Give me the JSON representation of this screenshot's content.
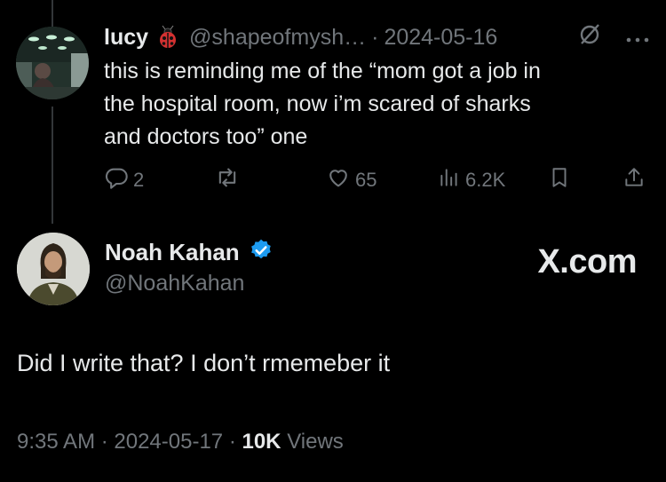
{
  "reply": {
    "name": "lucy",
    "handle": "@shapeofmysh…",
    "date": "2024-05-16",
    "text": "this is reminding me of the “mom got a job in\nthe hospital room, now i’m scared of sharks\nand doctors too” one",
    "replies": "2",
    "likes": "65",
    "views": "6.2K"
  },
  "post": {
    "name": "Noah Kahan",
    "handle": "@NoahKahan",
    "brand": "X.com",
    "text": "Did I write that? I don’t rmemeber it",
    "time": "9:35 AM",
    "date": "2024-05-17",
    "views_count": "10K",
    "views_label": "Views"
  },
  "colors": {
    "background": "#000000",
    "text": "#e7e9ea",
    "muted": "#71767b",
    "verified": "#1d9bf0"
  },
  "icons": [
    "ladybug-icon",
    "grok-icon",
    "more-icon",
    "reply-icon",
    "retweet-icon",
    "like-icon",
    "views-icon",
    "bookmark-icon",
    "share-icon",
    "verified-icon"
  ]
}
